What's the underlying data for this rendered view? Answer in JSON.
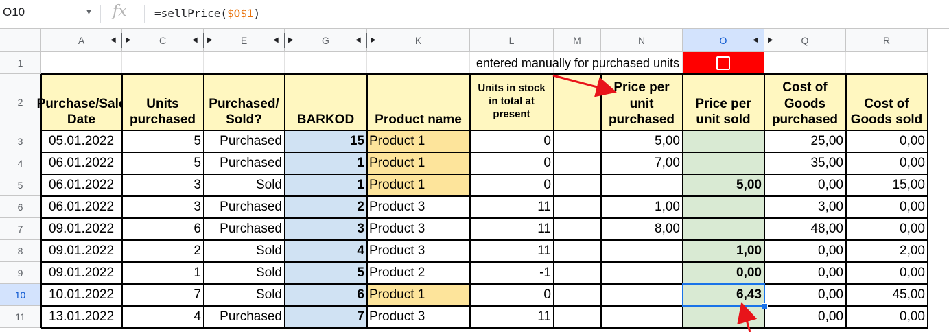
{
  "formula_bar": {
    "name_box": "O10",
    "fx_label": "fx",
    "formula_prefix": "=sellPrice(",
    "formula_ref": "$O$1",
    "formula_suffix": ")"
  },
  "columns": [
    "A",
    "C",
    "E",
    "G",
    "K",
    "L",
    "M",
    "N",
    "O",
    "Q",
    "R"
  ],
  "rows": [
    "1",
    "2",
    "3",
    "4",
    "5",
    "6",
    "7",
    "8",
    "9",
    "10",
    "11"
  ],
  "note_row1": "entered manually for purchased units",
  "headers": {
    "purchase_date": "Purchase/Sale Date",
    "units_purchased": "Units purchased",
    "purchased_sold": "Purchased/ Sold?",
    "barkod": "BARKOD",
    "product_name": "Product name",
    "units_in_stock": "Units in stock in total at present",
    "blank_m": "",
    "price_unit_purchased": "Price per unit purchased",
    "price_unit_sold": "Price per unit sold",
    "cost_goods_purchased": "Cost of Goods purchased",
    "cost_goods_sold": "Cost of Goods sold"
  },
  "data_rows": [
    {
      "date": "05.01.2022",
      "units": "5",
      "ps": "Purchased",
      "barkod": "15",
      "product": "Product 1",
      "stock": "0",
      "m": "",
      "ppu": "5,00",
      "psu": "",
      "cgp": "25,00",
      "cgs": "0,00",
      "hl": true
    },
    {
      "date": "06.01.2022",
      "units": "5",
      "ps": "Purchased",
      "barkod": "1",
      "product": "Product 1",
      "stock": "0",
      "m": "",
      "ppu": "7,00",
      "psu": "",
      "cgp": "35,00",
      "cgs": "0,00",
      "hl": true
    },
    {
      "date": "06.01.2022",
      "units": "3",
      "ps": "Sold",
      "barkod": "1",
      "product": "Product 1",
      "stock": "0",
      "m": "",
      "ppu": "",
      "psu": "5,00",
      "cgp": "0,00",
      "cgs": "15,00",
      "hl": true
    },
    {
      "date": "06.01.2022",
      "units": "3",
      "ps": "Purchased",
      "barkod": "2",
      "product": "Product 3",
      "stock": "11",
      "m": "",
      "ppu": "1,00",
      "psu": "",
      "cgp": "3,00",
      "cgs": "0,00",
      "hl": false
    },
    {
      "date": "09.01.2022",
      "units": "6",
      "ps": "Purchased",
      "barkod": "3",
      "product": "Product 3",
      "stock": "11",
      "m": "",
      "ppu": "8,00",
      "psu": "",
      "cgp": "48,00",
      "cgs": "0,00",
      "hl": false
    },
    {
      "date": "09.01.2022",
      "units": "2",
      "ps": "Sold",
      "barkod": "4",
      "product": "Product 3",
      "stock": "11",
      "m": "",
      "ppu": "",
      "psu": "1,00",
      "cgp": "0,00",
      "cgs": "2,00",
      "hl": false
    },
    {
      "date": "09.01.2022",
      "units": "1",
      "ps": "Sold",
      "barkod": "5",
      "product": "Product 2",
      "stock": "-1",
      "m": "",
      "ppu": "",
      "psu": "0,00",
      "cgp": "0,00",
      "cgs": "0,00",
      "hl": false
    },
    {
      "date": "10.01.2022",
      "units": "7",
      "ps": "Sold",
      "barkod": "6",
      "product": "Product 1",
      "stock": "0",
      "m": "",
      "ppu": "",
      "psu": "6,43",
      "cgp": "0,00",
      "cgs": "45,00",
      "hl": true
    },
    {
      "date": "13.01.2022",
      "units": "4",
      "ps": "Purchased",
      "barkod": "7",
      "product": "Product 3",
      "stock": "11",
      "m": "",
      "ppu": "",
      "psu": "",
      "cgp": "0,00",
      "cgs": "0,00",
      "hl": false
    }
  ],
  "colors": {
    "header_fill": "#fff7c0",
    "barkod_fill": "#d0e2f3",
    "sold_price_fill": "#d9ead3",
    "product_highlight": "#fde49b",
    "checkbox_fill": "#ff0000",
    "annotation_arrow": "#e8141a",
    "selection": "#1a73e8"
  },
  "selected_cell": "O10"
}
